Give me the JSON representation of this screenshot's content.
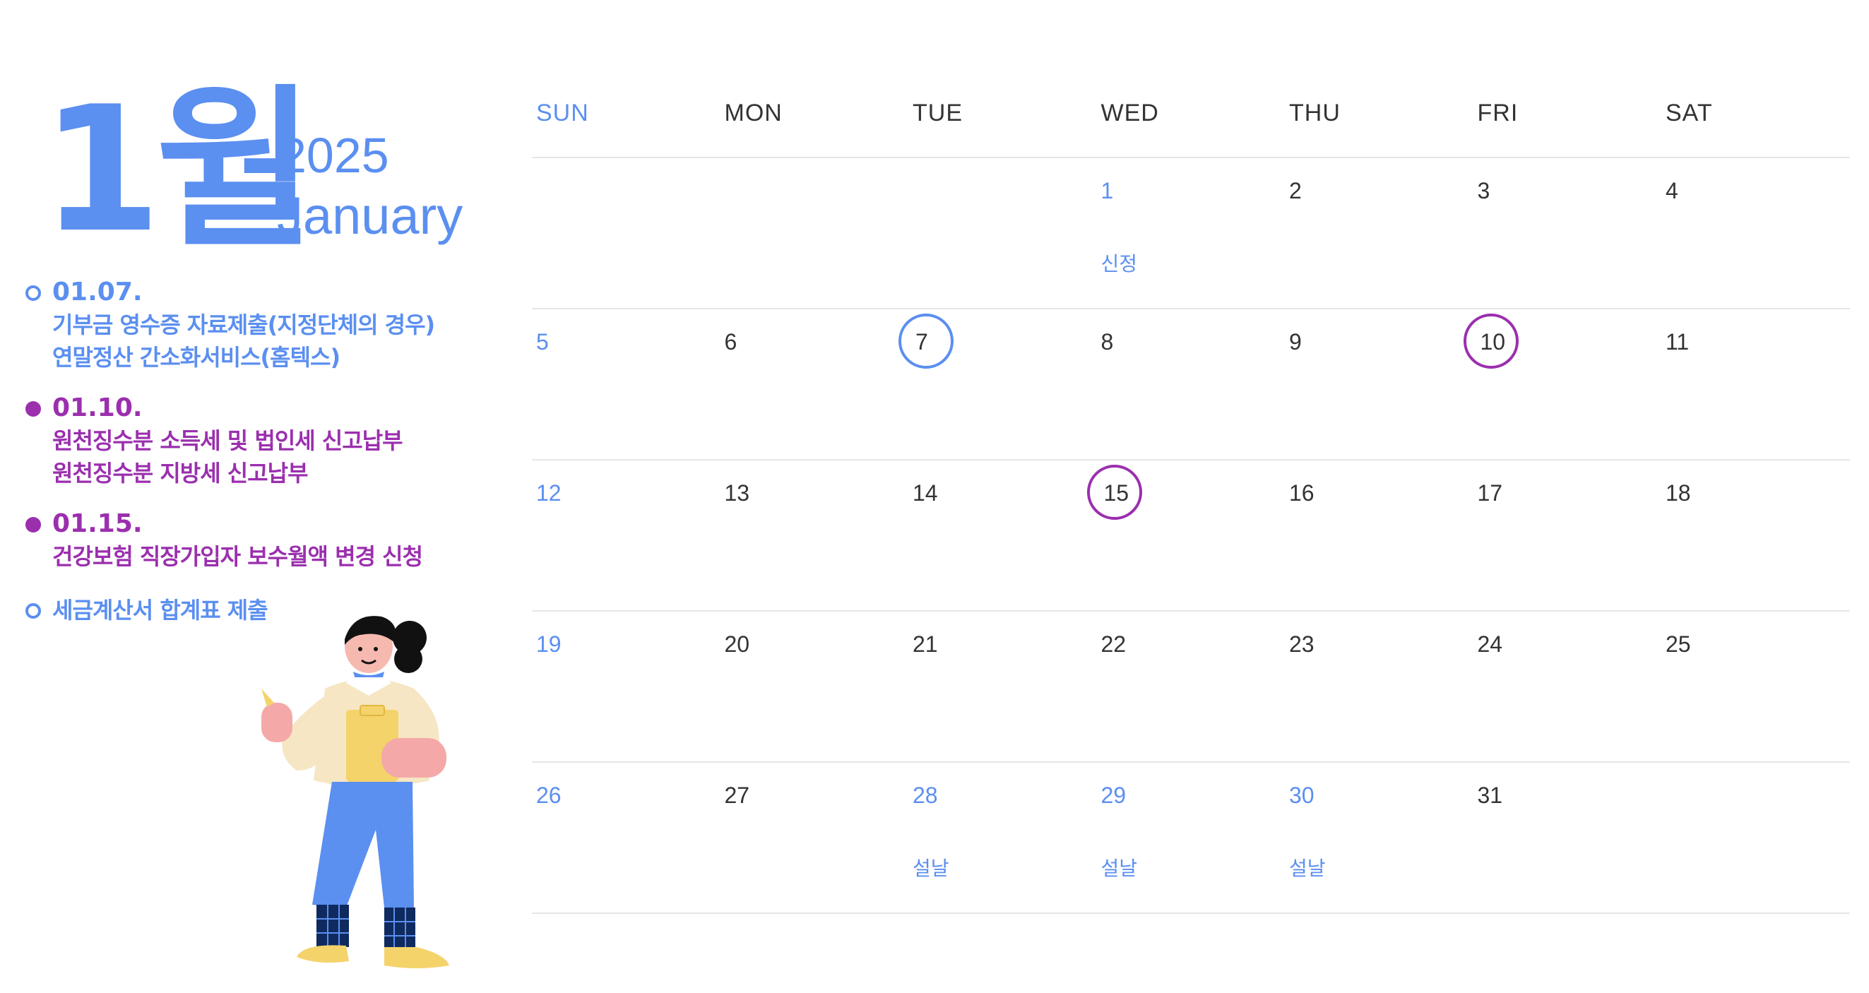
{
  "header": {
    "month_kr": "1월",
    "year": "2025",
    "month_en": "January"
  },
  "schedule": [
    {
      "bullet": "hollow",
      "color": "#5b8ff0",
      "date": "01.07.",
      "lines": [
        "기부금 영수증 자료제출(지정단체의 경우)",
        "연말정산 간소화서비스(홈텍스)"
      ]
    },
    {
      "bullet": "filled",
      "color": "#9b2fae",
      "date": "01.10.",
      "lines": [
        "원천징수분 소득세 및 법인세 신고납부",
        "원천징수분 지방세 신고납부"
      ]
    },
    {
      "bullet": "filled",
      "color": "#9b2fae",
      "date": "01.15.",
      "lines": [
        "건강보험 직장가입자 보수월액 변경 신청"
      ]
    },
    {
      "bullet": "hollow",
      "color": "#5b8ff0",
      "date": "",
      "lines": [
        "세금계산서 합계표 제출"
      ]
    }
  ],
  "calendar": {
    "weekdays": [
      "SUN",
      "MON",
      "TUE",
      "WED",
      "THU",
      "FRI",
      "SAT"
    ],
    "weeks": [
      [
        "",
        "",
        "",
        "1",
        "2",
        "3",
        "4"
      ],
      [
        "5",
        "6",
        "7",
        "8",
        "9",
        "10",
        "11"
      ],
      [
        "12",
        "13",
        "14",
        "15",
        "16",
        "17",
        "18"
      ],
      [
        "19",
        "20",
        "21",
        "22",
        "23",
        "24",
        "25"
      ],
      [
        "26",
        "27",
        "28",
        "29",
        "30",
        "31",
        ""
      ]
    ],
    "holidays": [
      {
        "day": "1",
        "label": "신정"
      },
      {
        "day": "28",
        "label": "설날"
      },
      {
        "day": "29",
        "label": "설날"
      },
      {
        "day": "30",
        "label": "설날"
      }
    ],
    "circled": [
      {
        "day": "7",
        "color": "blue"
      },
      {
        "day": "10",
        "color": "purple"
      },
      {
        "day": "15",
        "color": "purple"
      }
    ]
  },
  "colors": {
    "accent": "#5b8ff0",
    "purple": "#9b2fae",
    "text": "#333333",
    "rule": "#e6e6e6"
  },
  "illustration": "woman-with-clipboard"
}
